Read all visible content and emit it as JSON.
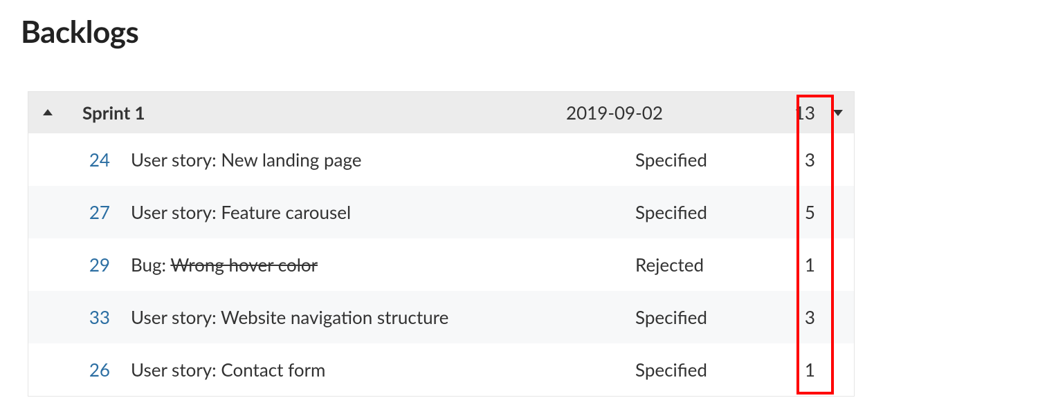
{
  "page": {
    "title": "Backlogs"
  },
  "sprint": {
    "name": "Sprint 1",
    "date": "2019-09-02",
    "total_points": "13"
  },
  "items": [
    {
      "id": "24",
      "type_label": "User story:",
      "title": "New landing page",
      "status": "Specified",
      "points": "3",
      "rejected": false
    },
    {
      "id": "27",
      "type_label": "User story:",
      "title": "Feature carousel",
      "status": "Specified",
      "points": "5",
      "rejected": false
    },
    {
      "id": "29",
      "type_label": "Bug:",
      "title": "Wrong hover color",
      "status": "Rejected",
      "points": "1",
      "rejected": true
    },
    {
      "id": "33",
      "type_label": "User story:",
      "title": "Website navigation structure",
      "status": "Specified",
      "points": "3",
      "rejected": false
    },
    {
      "id": "26",
      "type_label": "User story:",
      "title": "Contact form",
      "status": "Specified",
      "points": "1",
      "rejected": false
    }
  ]
}
